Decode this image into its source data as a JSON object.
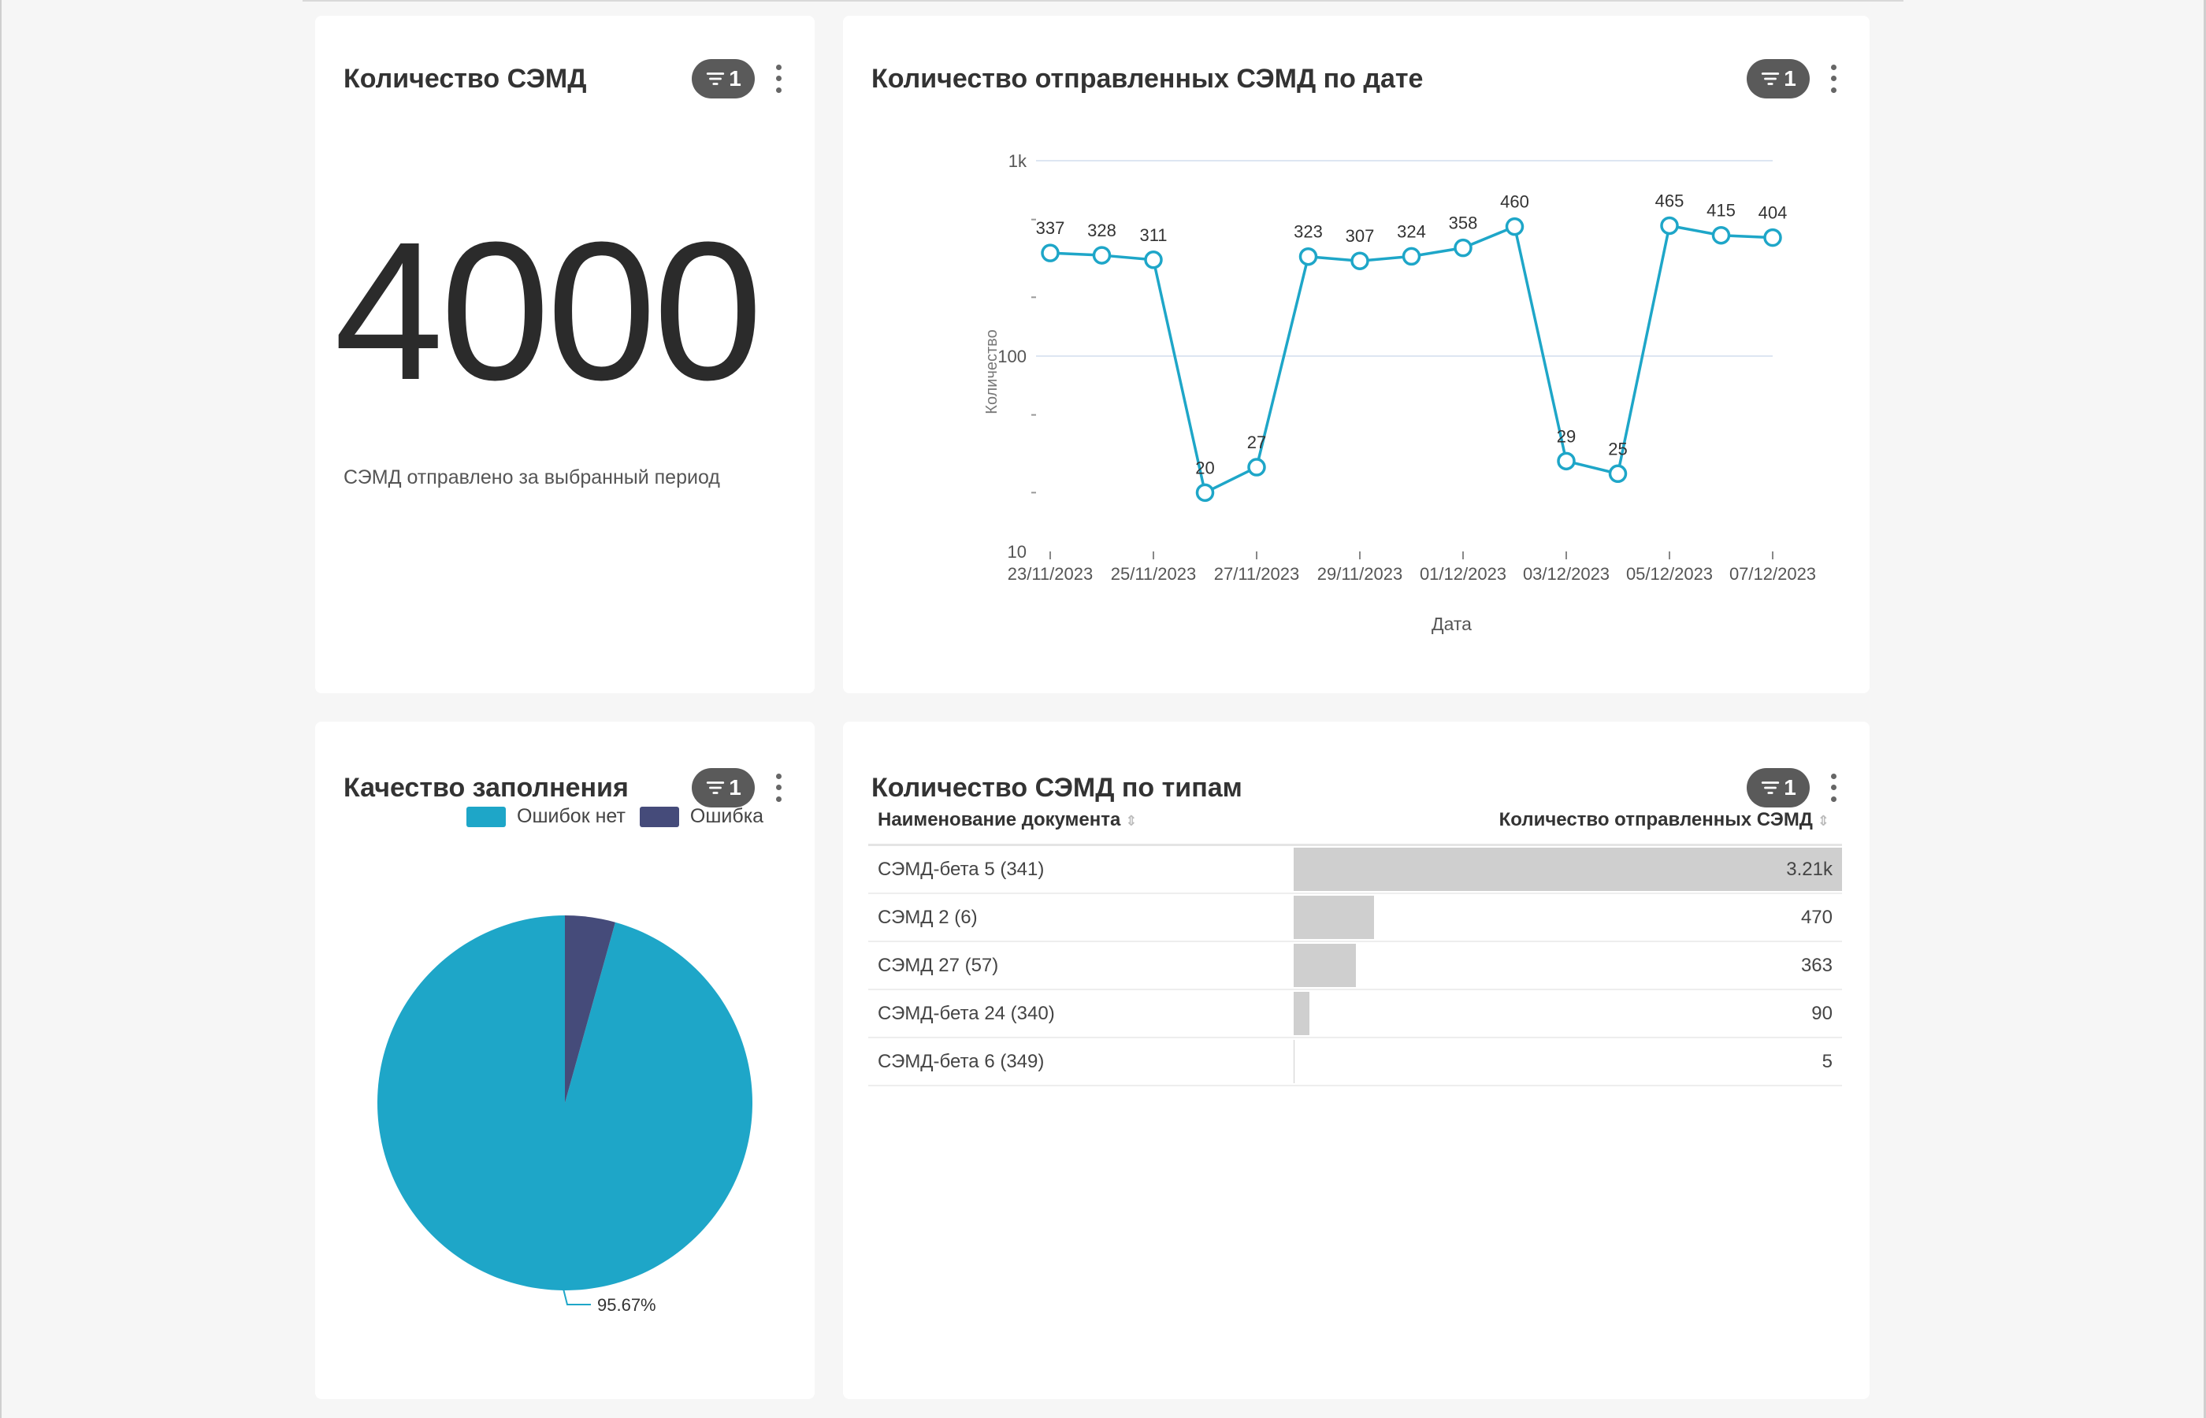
{
  "cards": {
    "total": {
      "title": "Количество СЭМД",
      "filter_count": "1",
      "value": "4000",
      "subtitle": "СЭМД отправлено за выбранный период"
    },
    "by_date": {
      "title": "Количество отправленных СЭМД по дате",
      "filter_count": "1"
    },
    "quality": {
      "title": "Качество заполнения",
      "filter_count": "1"
    },
    "by_type": {
      "title": "Количество СЭМД по типам",
      "filter_count": "1",
      "columns": [
        "Наименование документа",
        "Количество отправленных СЭМД"
      ],
      "rows": [
        {
          "name": "СЭМД-бета 5 (341)",
          "value": 3210,
          "label": "3.21k"
        },
        {
          "name": "СЭМД 2 (6)",
          "value": 470,
          "label": "470"
        },
        {
          "name": "СЭМД 27 (57)",
          "value": 363,
          "label": "363"
        },
        {
          "name": "СЭМД-бета 24 (340)",
          "value": 90,
          "label": "90"
        },
        {
          "name": "СЭМД-бета 6 (349)",
          "value": 5,
          "label": "5"
        }
      ]
    }
  },
  "colors": {
    "line": "#1ea6c8",
    "pie_ok": "#1ea6c8",
    "pie_err": "#454b7a",
    "badge": "#5a5a5a"
  },
  "icons": {
    "filter": "filter-icon",
    "menu": "kebab-menu-icon"
  },
  "chart_data": [
    {
      "type": "line",
      "title": "Количество отправленных СЭМД по дате",
      "xlabel": "Дата",
      "ylabel": "Количество",
      "yscale": "log",
      "ylim": [
        10,
        1000
      ],
      "y_ticks": [
        "10",
        "100",
        "1k"
      ],
      "x_tick_labels": [
        "23/11/2023",
        "25/11/2023",
        "27/11/2023",
        "29/11/2023",
        "01/12/2023",
        "03/12/2023",
        "05/12/2023",
        "07/12/2023"
      ],
      "x": [
        "23/11/2023",
        "24/11/2023",
        "25/11/2023",
        "26/11/2023",
        "27/11/2023",
        "28/11/2023",
        "29/11/2023",
        "30/11/2023",
        "01/12/2023",
        "02/12/2023",
        "03/12/2023",
        "04/12/2023",
        "05/12/2023",
        "06/12/2023",
        "07/12/2023"
      ],
      "values": [
        337,
        328,
        311,
        20,
        27,
        323,
        307,
        324,
        358,
        460,
        29,
        25,
        465,
        415,
        404
      ],
      "grid": true
    },
    {
      "type": "pie",
      "categories": [
        "Ошибок нет",
        "Ошибка"
      ],
      "values": [
        95.67,
        4.33
      ],
      "labels": [
        "95.67%"
      ],
      "legend": "top-right"
    }
  ]
}
